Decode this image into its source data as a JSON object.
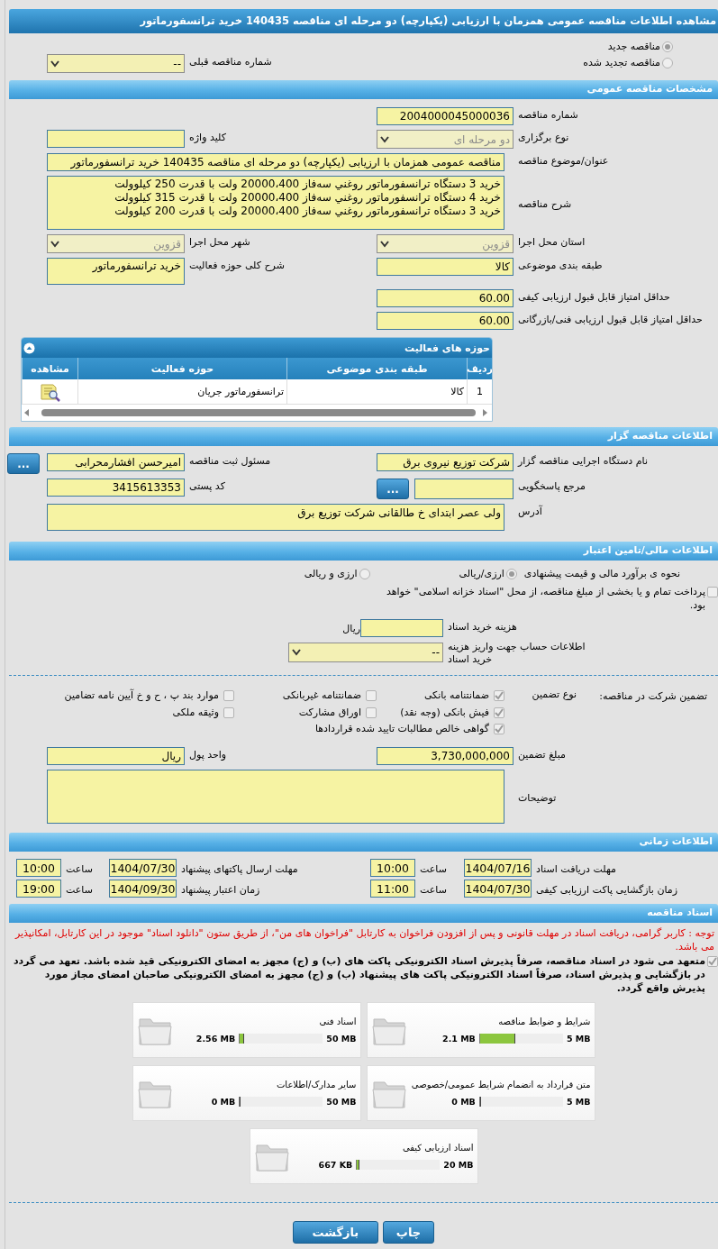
{
  "title": "مشاهده اطلاعات مناقصه عمومی همزمان با ارزیابی (یکپارچه) دو مرحله ای مناقصه 140435 خرید ترانسفورماتور",
  "tender_status": [
    {
      "label": "مناقصه جدید",
      "selected": true
    },
    {
      "label": "مناقصه تجدید شده",
      "selected": false
    }
  ],
  "previous_tender": {
    "label": "شماره مناقصه قبلی",
    "kind": "select",
    "value": "--",
    "disabled": false
  },
  "general": {
    "title": "مشخصات مناقصه عمومی",
    "rows": [
      {
        "right": {
          "label": "شماره مناقصه",
          "kind": "input",
          "value": "2004000045000036"
        }
      },
      {
        "right": {
          "label": "نوع برگزاری",
          "kind": "select",
          "value": "دو مرحله ای",
          "disabled": true
        },
        "left": {
          "label": "کلید واژه",
          "kind": "input"
        }
      },
      {
        "wide": {
          "label": "عنوان/موضوع مناقصه",
          "kind": "input",
          "value": "مناقصه عمومی همزمان با ارزیابی (یکپارچه) دو مرحله ای مناقصه 140435 خرید  ترانسفورماتور"
        }
      },
      {
        "wide": {
          "label": "شرح مناقصه",
          "kind": "textarea",
          "value": "خرید 3 دستگاه  ترانسفورماتور روغني سه‌فاز 20000،400 ولت با قدرت 250 کیلوولت\nخرید 4 دستگاه  ترانسفورماتور روغني سه‌فاز 20000،400 ولت با قدرت 315 کیلوولت\nخرید 3 دستگاه  ترانسفورماتور روغني سه‌فاز 20000،400 ولت با قدرت 200 کیلوولت"
        }
      },
      {
        "right": {
          "label": "استان محل اجرا",
          "kind": "select",
          "value": "قزوین",
          "disabled": true
        },
        "left": {
          "label": "شهر محل اجرا",
          "kind": "select",
          "value": "قزوین",
          "disabled": true
        }
      },
      {
        "right": {
          "label": "طبقه بندی موضوعی",
          "kind": "input",
          "value": "کالا"
        },
        "left": {
          "label": "شرح کلی حوزه فعالیت",
          "kind": "textarea",
          "value": "خرید  ترانسفورماتور"
        }
      },
      {
        "right": {
          "label": "حداقل امتیاز قابل قبول ارزیابی کیفی",
          "kind": "input",
          "value": "60.00"
        }
      },
      {
        "right": {
          "label": "حداقل امتیاز قابل قبول ارزیابی فنی/بازرگانی",
          "kind": "input",
          "value": "60.00"
        }
      }
    ],
    "activities": {
      "title": "حوزه های فعالیت",
      "columns": [
        "ردیف",
        "طبقه بندی موضوعی",
        "حوزه فعالیت",
        "مشاهده"
      ],
      "rows": [
        {
          "cells": [
            "1",
            "کالا",
            "ترانسفورماتور جریان"
          ]
        }
      ]
    }
  },
  "organizer": {
    "title": "اطلاعات مناقصه گزار",
    "rows": [
      {
        "right": {
          "label": "نام دستگاه اجرایی مناقصه گزار",
          "kind": "input",
          "value": "شرکت توزیع نیروی برق"
        },
        "left": {
          "label": "مسئول ثبت مناقصه",
          "kind": "input",
          "value": "امیرحسن افشارمحرابی",
          "button": "..."
        }
      },
      {
        "right": {
          "label": "مرجع پاسخگویی",
          "kind": "input",
          "button": "..."
        },
        "left": {
          "label": "کد پستی",
          "kind": "input",
          "value": "3415613353"
        }
      },
      {
        "wide": {
          "label": "آدرس",
          "kind": "input",
          "value": "ولی عصر ابتدای خ طالقانی شرکت توزیع برق"
        }
      }
    ]
  },
  "finance": {
    "title": "اطلاعات مالی/تامین اعتبار",
    "estimate_method": {
      "label": "نحوه ی برآورد مالی و قیمت پیشنهادی",
      "options": [
        {
          "label": "ارزی/ریالی",
          "selected": true
        },
        {
          "label": "ارزی و ریالی",
          "selected": false
        }
      ]
    },
    "islamic_treasury": {
      "label": "پرداخت تمام و یا بخشی از مبلغ مناقصه، از محل \"اسناد خزانه اسلامی\" خواهد بود.",
      "checked": false
    },
    "document_fee": {
      "label": "هزینه خرید اسناد",
      "unit": "ریال"
    },
    "fee_account": {
      "label": "اطلاعات حساب جهت واریز هزینه خرید اسناد",
      "kind": "select",
      "value": "--",
      "disabled": false
    }
  },
  "guarantee": {
    "label": "تضمین شرکت در مناقصه:",
    "type_label": "نوع تضمین",
    "options": [
      {
        "label": "ضمانتنامه بانکی",
        "checked": true
      },
      {
        "label": "ضمانتنامه غیربانکی",
        "checked": false
      },
      {
        "label": "موارد بند پ ، ح و خ آیین نامه تضامین",
        "checked": false
      },
      {
        "label": "فیش بانکی (وجه نقد)",
        "checked": true
      },
      {
        "label": "اوراق مشارکت",
        "checked": false
      },
      {
        "label": "وثیقه ملکی",
        "checked": false
      },
      {
        "label": "گواهی خالص مطالبات تایید شده قراردادها",
        "checked": true
      }
    ],
    "rows": [
      {
        "right": {
          "label": "مبلغ تضمین",
          "kind": "input",
          "value": "3,730,000,000"
        },
        "left": {
          "label": "واحد پول",
          "kind": "input",
          "value": "ریال"
        }
      },
      {
        "wide": {
          "label": "توضیحات",
          "kind": "textarea"
        }
      }
    ]
  },
  "timing": {
    "title": "اطلاعات زمانی",
    "rows": [
      {
        "right": {
          "label": "مهلت دریافت اسناد",
          "date": "1404/07/16",
          "time_label": "ساعت",
          "time": "10:00"
        },
        "left": {
          "label": "مهلت ارسال پاکتهای پیشنهاد",
          "date": "1404/07/30",
          "time_label": "ساعت",
          "time": "10:00"
        }
      },
      {
        "right": {
          "label": "زمان بازگشایی پاکت ارزیابی کیفی",
          "date": "1404/07/30",
          "time_label": "ساعت",
          "time": "11:00"
        },
        "left": {
          "label": "زمان اعتبار پیشنهاد",
          "date": "1404/09/30",
          "time_label": "ساعت",
          "time": "19:00"
        }
      }
    ]
  },
  "documents": {
    "title": "اسناد مناقصه",
    "notice": "توجه : کاربر گرامی، دریافت اسناد در مهلت قانونی و پس از افزودن فراخوان به کارتابل \"فراخوان های من\"، از طریق ستون \"دانلود اسناد\" موجود در این کارتابل، امکانپذیر می باشد.",
    "commitment": {
      "text": "متعهد می شود در اسناد مناقصه، صرفاً پذیرش اسناد الکترونیکی پاکت های (ب) و (ج) مجهز به امضای الکترونیکی قید شده باشد. تعهد می گردد در بازگشایی و پذیرش اسناد، صرفاً اسناد الکترونیکی پاکت های پیشنهاد (ب) و (ج) مجهز به امضای الکترونیکی صاحبان امضای مجاز مورد پذیرش واقع گردد.",
      "checked": true
    },
    "files": [
      {
        "title": "شرایط و ضوابط مناقصه",
        "size": "2.1 MB",
        "max": "5 MB",
        "level": 0.42
      },
      {
        "title": "اسناد فنی",
        "size": "2.56 MB",
        "max": "50 MB",
        "level": 0.05
      },
      {
        "title": "متن قرارداد به انضمام شرایط عمومی/خصوصی",
        "size": "0 MB",
        "max": "5 MB",
        "level": 0
      },
      {
        "title": "سایر مدارک/اطلاعات",
        "size": "0 MB",
        "max": "50 MB",
        "level": 0
      },
      {
        "title": "اسناد ارزیابی کیفی",
        "size": "667 KB",
        "max": "20 MB",
        "level": 0.03
      }
    ]
  },
  "buttons": [
    "چاپ",
    "بازگشت"
  ]
}
